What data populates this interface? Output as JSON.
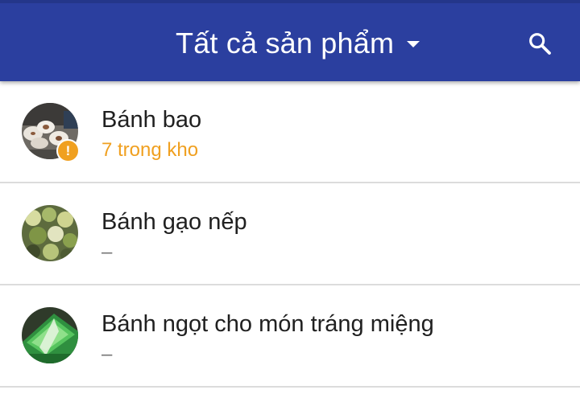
{
  "app_bar": {
    "title": "Tất cả sản phẩm",
    "background_color": "#2b3f9f",
    "caret_icon": "arrow-drop-down-icon",
    "search_icon": "search-icon"
  },
  "products": [
    {
      "name": "Bánh bao",
      "stock_text": "7 trong kho",
      "low_stock": true,
      "badge_icon": "warning-icon",
      "badge_symbol": "!",
      "badge_color": "#f0a020"
    },
    {
      "name": "Bánh gạo nếp",
      "stock_text": "–",
      "low_stock": false
    },
    {
      "name": "Bánh ngọt cho món tráng miệng",
      "stock_text": "–",
      "low_stock": false
    }
  ]
}
